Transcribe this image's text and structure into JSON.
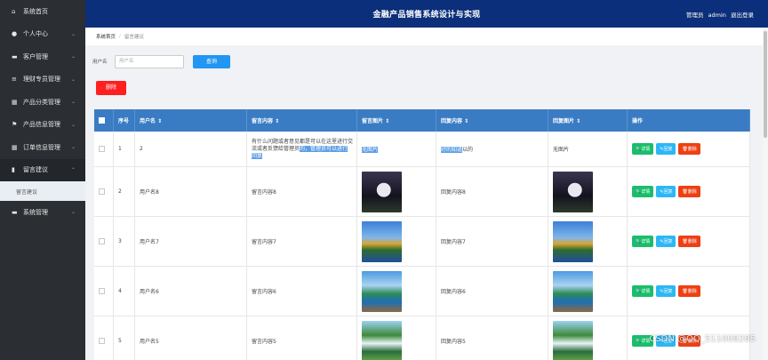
{
  "sidebar": {
    "items": [
      {
        "icon": "home-icon",
        "glyph": "⌂",
        "label": "系统首页",
        "chevron": ""
      },
      {
        "icon": "user-icon",
        "glyph": "●",
        "label": "个人中心",
        "chevron": "⌄"
      },
      {
        "icon": "monitor-icon",
        "glyph": "▬",
        "label": "客户管理",
        "chevron": "⌄"
      },
      {
        "icon": "list-icon",
        "glyph": "≡",
        "label": "理财专员管理",
        "chevron": "⌄"
      },
      {
        "icon": "grid-icon",
        "glyph": "▦",
        "label": "产品分类管理",
        "chevron": "⌄"
      },
      {
        "icon": "flag-icon",
        "glyph": "⚑",
        "label": "产品信息管理",
        "chevron": "⌄"
      },
      {
        "icon": "grid-icon",
        "glyph": "▦",
        "label": "订单信息管理",
        "chevron": "⌄"
      },
      {
        "icon": "book-icon",
        "glyph": "▮",
        "label": "留言建议",
        "chevron": "⌃"
      },
      {
        "icon": "monitor-icon",
        "glyph": "▬",
        "label": "系统管理",
        "chevron": "⌄"
      }
    ],
    "sub_item": "留言建议"
  },
  "header": {
    "title": "金融产品销售系统设计与实现",
    "role": "管理员",
    "username": "admin",
    "logout": "退出登录"
  },
  "breadcrumb": {
    "home": "系统首页",
    "current": "留言建议"
  },
  "search": {
    "label": "用户名",
    "placeholder": "用户名",
    "button": "查询"
  },
  "actions": {
    "delete": "删除"
  },
  "table": {
    "headers": [
      "",
      "序号",
      "用户名 ⇕",
      "留言内容 ⇕",
      "留言图片 ⇕",
      "回复内容 ⇕",
      "回复图片 ⇕",
      "操作"
    ],
    "rows": [
      {
        "idx": "1",
        "user": "2",
        "content_a": "有什么问题或者意见都是可以在这里进行交流或者反馈给管理员",
        "content_b": "的，管理员可以进行回复",
        "image": "无图片",
        "reply_a": "好的",
        "reply_b": "知道",
        "reply_image": "无图片",
        "img": ""
      },
      {
        "idx": "2",
        "user": "用户名8",
        "content_a": "留言内容8",
        "content_b": "",
        "image": "",
        "reply_a": "回复内容8",
        "reply_b": "",
        "reply_image": "",
        "img": "moon"
      },
      {
        "idx": "3",
        "user": "用户名7",
        "content_a": "留言内容7",
        "content_b": "",
        "image": "",
        "reply_a": "回复内容7",
        "reply_b": "",
        "reply_image": "",
        "img": "tree"
      },
      {
        "idx": "4",
        "user": "用户名6",
        "content_a": "留言内容6",
        "content_b": "",
        "image": "",
        "reply_a": "回复内容6",
        "reply_b": "",
        "reply_image": "",
        "img": "lake"
      },
      {
        "idx": "5",
        "user": "用户名5",
        "content_a": "留言内容5",
        "content_b": "",
        "image": "",
        "reply_a": "回复内容5",
        "reply_b": "",
        "reply_image": "",
        "img": "fall"
      }
    ],
    "buttons": {
      "detail": "详情",
      "reply": "回复",
      "delete": "删除"
    }
  },
  "watermark": "CSDN @QQ_511008285"
}
